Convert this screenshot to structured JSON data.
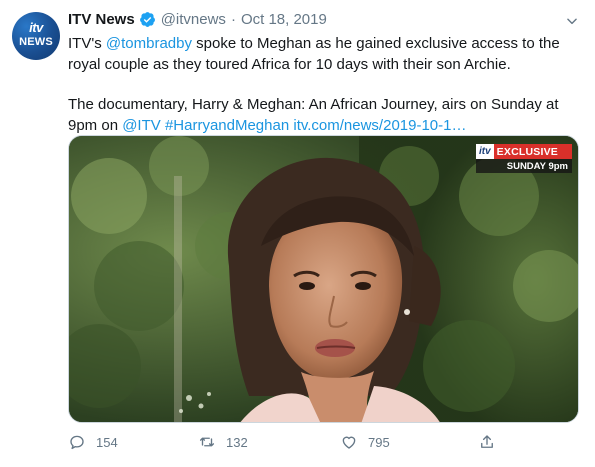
{
  "account": {
    "logo_top": "itv",
    "logo_bottom": "NEWS",
    "display_name": "ITV News",
    "handle": "@itvnews",
    "separator": "·",
    "date": "Oct 18, 2019"
  },
  "tweet": {
    "p1_before": "ITV's ",
    "p1_mention": "@tombradby",
    "p1_after": " spoke to Meghan as he gained exclusive access to the royal couple as they toured Africa for 10 days with their son Archie.",
    "p2_text": "The documentary, Harry & Meghan: An African Journey, airs on Sunday at 9pm on ",
    "p2_mention": "@ITV",
    "p2_hashtag": "#HarryandMeghan",
    "p2_url": "itv.com/news/2019-10-1…"
  },
  "media": {
    "badge_logo": "itv",
    "badge_label": "EXCLUSIVE",
    "badge_sub": "SUNDAY 9pm"
  },
  "actions": {
    "reply_count": "154",
    "retweet_count": "132",
    "like_count": "795"
  },
  "colors": {
    "link": "#1b95e0",
    "muted": "#657786",
    "verified": "#1da1f2",
    "exclusive_red": "#d9302a"
  }
}
